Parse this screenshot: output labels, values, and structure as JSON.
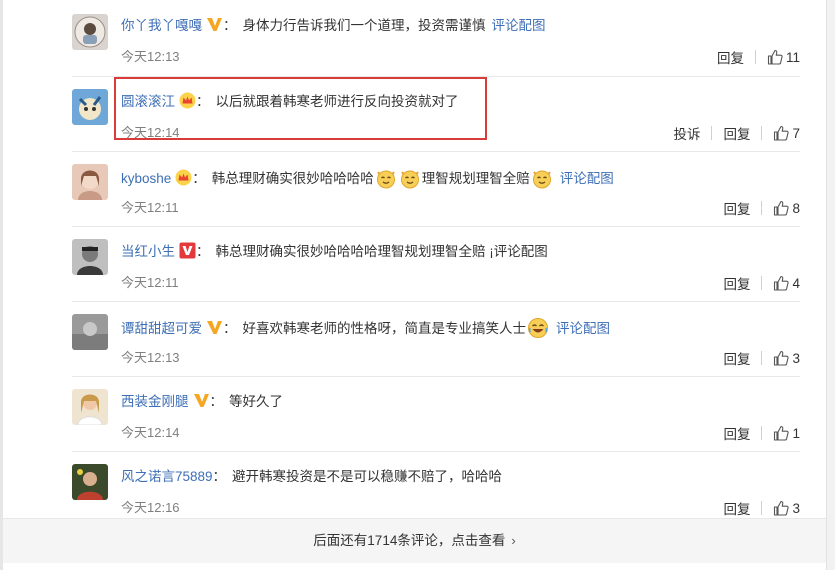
{
  "comments": [
    {
      "user": "你丫我丫嘎嘎",
      "badge": "v",
      "content": "身体力行告诉我们一个道理，投资需谨慎",
      "link": "评论配图",
      "time": "今天12:13",
      "reply": "回复",
      "likes": "11"
    },
    {
      "user": "圆滚滚江",
      "badge": "crown",
      "content": "以后就跟着韩寒老师进行反向投资就对了",
      "time": "今天12:14",
      "report": "投诉",
      "reply": "回复",
      "likes": "7"
    },
    {
      "user": "kyboshe",
      "badge": "crown",
      "content_a": "韩总理财确实很妙哈哈哈哈",
      "content_b": "理智规划理智全赔",
      "link": "评论配图",
      "time": "今天12:11",
      "reply": "回复",
      "likes": "8"
    },
    {
      "user": "当红小生",
      "badge": "vred",
      "content": "韩总理财确实很妙哈哈哈哈理智规划理智全赔 ¡评论配图",
      "time": "今天12:11",
      "reply": "回复",
      "likes": "4"
    },
    {
      "user": "谭甜甜超可爱",
      "badge": "v",
      "content": "好喜欢韩寒老师的性格呀，简直是专业搞笑人士",
      "link": "评论配图",
      "time": "今天12:13",
      "reply": "回复",
      "likes": "3"
    },
    {
      "user": "西装金刚腿",
      "badge": "v",
      "content": "等好久了",
      "time": "今天12:14",
      "reply": "回复",
      "likes": "1"
    },
    {
      "user": "风之诺言75889",
      "content": "避开韩寒投资是不是可以稳赚不赔了，哈哈哈",
      "time": "今天12:16",
      "reply": "回复",
      "likes": "3"
    }
  ],
  "more": {
    "label": "后面还有1714条评论，点击查看"
  },
  "colors": {
    "link": "#3e6fb6",
    "highlight": "#d93a3a",
    "time": "#808080"
  }
}
